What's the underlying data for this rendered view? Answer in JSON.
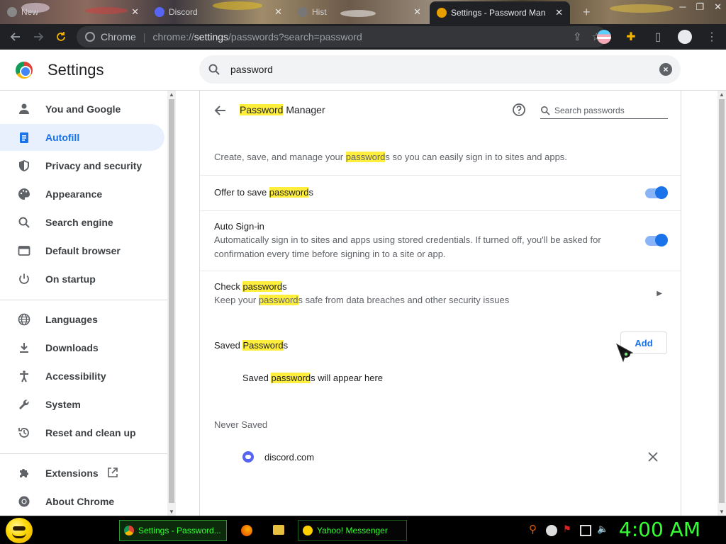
{
  "window": {
    "tabs": [
      {
        "label": "New",
        "active": false
      },
      {
        "label": "Discord",
        "active": false
      },
      {
        "label": "Hist",
        "active": false
      },
      {
        "label": "Settings - Password Man",
        "active": true
      }
    ],
    "new_tab": "+"
  },
  "toolbar": {
    "site_label": "Chrome",
    "url_host_prefix": "chrome://",
    "url_host": "settings",
    "url_path": "/passwords?search=password"
  },
  "settings": {
    "title": "Settings",
    "search_value": "password"
  },
  "sidebar": {
    "items": [
      {
        "label": "You and Google",
        "icon": "person-icon"
      },
      {
        "label": "Autofill",
        "icon": "clipboard-icon",
        "selected": true
      },
      {
        "label": "Privacy and security",
        "icon": "shield-icon"
      },
      {
        "label": "Appearance",
        "icon": "palette-icon"
      },
      {
        "label": "Search engine",
        "icon": "search-icon"
      },
      {
        "label": "Default browser",
        "icon": "browser-icon"
      },
      {
        "label": "On startup",
        "icon": "power-icon"
      },
      {
        "label": "Languages",
        "icon": "globe-icon"
      },
      {
        "label": "Downloads",
        "icon": "download-icon"
      },
      {
        "label": "Accessibility",
        "icon": "accessibility-icon"
      },
      {
        "label": "System",
        "icon": "wrench-icon"
      },
      {
        "label": "Reset and clean up",
        "icon": "history-icon"
      },
      {
        "label": "Extensions",
        "icon": "puzzle-icon"
      },
      {
        "label": "About Chrome",
        "icon": "chrome-icon"
      }
    ]
  },
  "password_manager": {
    "title_highlight": "Password",
    "title_rest": " Manager",
    "search_placeholder": "Search passwords",
    "description": {
      "pre": "Create, save, and manage your ",
      "hl": "password",
      "post": "s so you can easily sign in to sites and apps."
    },
    "offer_to_save": {
      "pre": "Offer to save ",
      "hl": "password",
      "post": "s",
      "enabled": true
    },
    "auto_signin": {
      "label": "Auto Sign-in",
      "line1": "Automatically sign in to sites and apps using stored credentials. If turned off, you'll be asked for",
      "line2": "confirmation every time before signing in to a site or app.",
      "enabled": true
    },
    "check_passwords": {
      "pre": "Check ",
      "hl": "password",
      "post": "s",
      "sub_pre": "Keep your ",
      "sub_hl": "password",
      "sub_post": "s safe from data breaches and other security issues"
    },
    "saved": {
      "pre": "Saved ",
      "hl": "Password",
      "post": "s",
      "add_label": "Add",
      "empty_pre": "Saved ",
      "empty_hl": "password",
      "empty_post": "s will appear here"
    },
    "never_saved": {
      "title": "Never Saved",
      "sites": [
        "discord.com"
      ]
    }
  },
  "taskbar": {
    "tasks": [
      {
        "label": "Settings - Password...",
        "active": true
      },
      {
        "label": "Yahoo! Messenger",
        "active": false
      }
    ],
    "clock": "4:00 AM"
  },
  "colors": {
    "accent": "#1a73e8",
    "highlight": "#ffef3c",
    "taskbar_text": "#33ff33"
  }
}
